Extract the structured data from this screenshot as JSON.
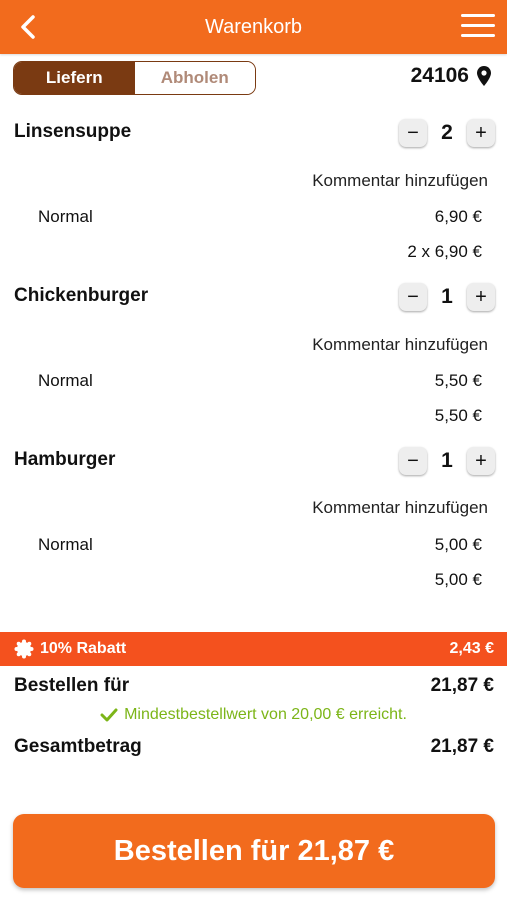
{
  "header": {
    "title": "Warenkorb",
    "back_icon": "chevron-left-icon",
    "menu_icon": "hamburger-menu-icon"
  },
  "mode_toggle": {
    "deliver_label": "Liefern",
    "pickup_label": "Abholen",
    "selected": "Liefern"
  },
  "postal_code": {
    "value": "24106",
    "icon": "map-pin-icon"
  },
  "cart": {
    "items": [
      {
        "name": "Linsensuppe",
        "quantity": "2",
        "comment_label": "Kommentar hinzufügen",
        "variant": "Normal",
        "unit_price": "6,90 €",
        "line_total": "2 x 6,90 €"
      },
      {
        "name": "Chickenburger",
        "quantity": "1",
        "comment_label": "Kommentar hinzufügen",
        "variant": "Normal",
        "unit_price": "5,50 €",
        "line_total": "5,50 €"
      },
      {
        "name": "Hamburger",
        "quantity": "1",
        "comment_label": "Kommentar hinzufügen",
        "variant": "Normal",
        "unit_price": "5,00 €",
        "line_total": "5,00 €"
      }
    ],
    "minus_symbol": "−",
    "plus_symbol": "+"
  },
  "discount": {
    "label": "10% Rabatt",
    "amount": "2,43 €",
    "icon": "discount-badge-icon"
  },
  "summary": {
    "order_for_label": "Bestellen für",
    "order_for_value": "21,87 €",
    "min_order_text": "Mindestbestellwert von 20,00 € erreicht.",
    "total_label": "Gesamtbetrag",
    "total_value": "21,87 €"
  },
  "order_button": {
    "label": "Bestellen für 21,87 €"
  },
  "colors": {
    "brand": "#f26b1d",
    "toggle_active": "#7a3a12",
    "discount_bar": "#f4511e",
    "success": "#7cb518"
  }
}
